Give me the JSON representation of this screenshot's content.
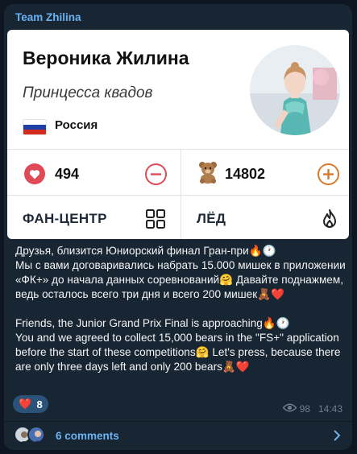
{
  "channel": {
    "name": "Team Zhilina"
  },
  "card": {
    "athlete_name": "Вероника Жилина",
    "nickname": "Принцесса квадов",
    "country": "Россия",
    "likes": "494",
    "bears": "14802",
    "fan_center": "ФАН-ЦЕНТР",
    "ice": "ЛЁД",
    "colors": {
      "heart": "#e04a57",
      "plus": "#d77a2d"
    }
  },
  "message": {
    "ru_line1": "Друзья, близится Юниорский финал Гран-при🔥🕐",
    "ru_line2": "Мы с вами договаривались набрать 15.000 мишек в приложении «ФК+» до начала данных соревнований🤗 Давайте поднажмем, ведь осталось всего три дня и всего 200 мишек🧸❤️",
    "en_line1": "Friends, the Junior Grand Prix Final is approaching🔥🕐",
    "en_line2": "You and we agreed to collect 15,000 bears in the \"FS+\" application before the start of these competitions🤗 Let's press, because there are only three days left and only 200 bears🧸❤️"
  },
  "reaction": {
    "emoji": "❤️",
    "count": "8"
  },
  "meta": {
    "views": "98",
    "time": "14:43"
  },
  "comments": {
    "label": "6 comments"
  }
}
